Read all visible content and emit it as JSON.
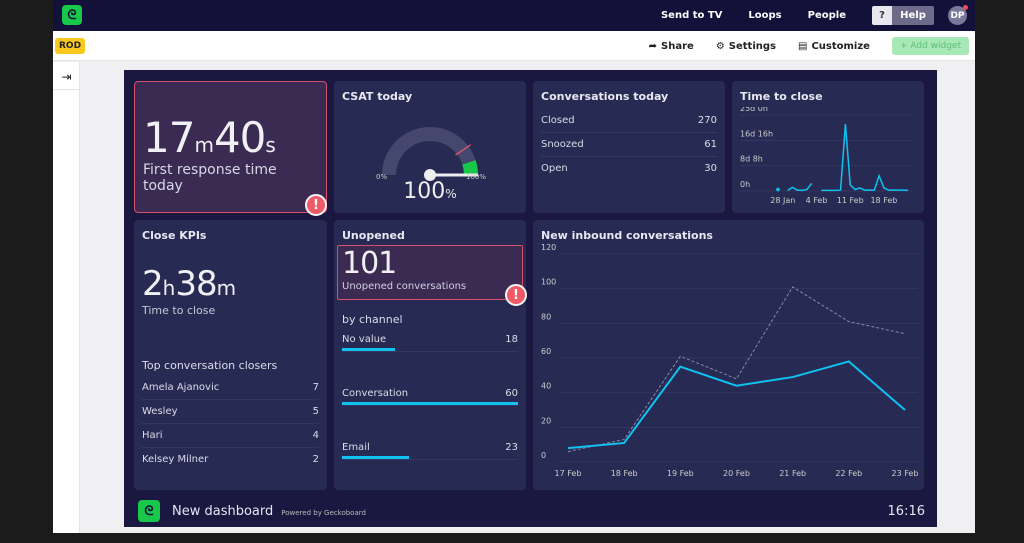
{
  "topbar": {
    "nav": [
      "Send to TV",
      "Loops",
      "People"
    ],
    "help_q": "?",
    "help": "Help",
    "avatar": "DP"
  },
  "toolbar": {
    "badge": "ROD",
    "share": "Share",
    "settings": "Settings",
    "customize": "Customize",
    "add_widget": "+ Add widget"
  },
  "colors": {
    "accent": "#0fc2f0",
    "alert": "#d9506a",
    "green": "#17c84a",
    "panel": "#272a52",
    "background": "#1a1740"
  },
  "widgets": {
    "frt": {
      "value_min": "17",
      "unit_min": "m",
      "value_sec": "40",
      "unit_sec": "s",
      "label": "First response time today",
      "alert": "!"
    },
    "csat": {
      "title": "CSAT today",
      "min": "0",
      "max": "100",
      "unit": "%",
      "value": "100",
      "value_pct": 100,
      "threshold_pct": 80
    },
    "conv": {
      "title": "Conversations today",
      "rows": [
        {
          "label": "Closed",
          "value": "270"
        },
        {
          "label": "Snoozed",
          "value": "61"
        },
        {
          "label": "Open",
          "value": "30"
        }
      ]
    },
    "ttc": {
      "title": "Time to close"
    },
    "close": {
      "title": "Close KPIs",
      "h": "2",
      "hu": "h",
      "m": "38",
      "mu": "m",
      "label": "Time to close",
      "list_title": "Top conversation closers",
      "rows": [
        {
          "label": "Amela Ajanovic",
          "value": "7"
        },
        {
          "label": "Wesley",
          "value": "5"
        },
        {
          "label": "Hari",
          "value": "4"
        },
        {
          "label": "Kelsey Milner",
          "value": "2"
        }
      ]
    },
    "unopened": {
      "title": "Unopened",
      "value": "101",
      "label": "Unopened conversations",
      "alert": "!",
      "by": "by channel",
      "channels": [
        {
          "label": "No value",
          "value": "18",
          "n": 18
        },
        {
          "label": "Conversation",
          "value": "60",
          "n": 60
        },
        {
          "label": "Email",
          "value": "23",
          "n": 23
        }
      ]
    },
    "inbound": {
      "title": "New inbound conversations"
    }
  },
  "chart_data": [
    {
      "type": "line",
      "title": "Time to close",
      "y_ticks": [
        "0h",
        "8d 8h",
        "16d 16h",
        "25d 0h"
      ],
      "ylim_days": [
        0,
        25
      ],
      "x_ticks": [
        "28 Jan",
        "4 Feb",
        "11 Feb",
        "18 Feb"
      ],
      "x": [
        "27 Jan",
        "28 Jan",
        "29 Jan",
        "30 Jan",
        "31 Jan",
        "1 Feb",
        "2 Feb",
        "3 Feb",
        "4 Feb",
        "5 Feb",
        "6 Feb",
        "7 Feb",
        "8 Feb",
        "9 Feb",
        "10 Feb",
        "11 Feb",
        "12 Feb",
        "13 Feb",
        "14 Feb",
        "15 Feb",
        "16 Feb",
        "17 Feb",
        "18 Feb",
        "19 Feb",
        "20 Feb",
        "21 Feb",
        "22 Feb",
        "23 Feb"
      ],
      "values_days": [
        0.5,
        null,
        0.2,
        1.2,
        0.3,
        0.2,
        0.5,
        2.5,
        null,
        0.2,
        0.2,
        0.2,
        0.2,
        0.3,
        22,
        2,
        0.5,
        1,
        0.3,
        0.3,
        0.3,
        5,
        1,
        0.3,
        0.3,
        0.3,
        0.3,
        0.2
      ],
      "grid": true
    },
    {
      "type": "line",
      "title": "New inbound conversations",
      "categories": [
        "17 Feb",
        "18 Feb",
        "19 Feb",
        "20 Feb",
        "21 Feb",
        "22 Feb",
        "23 Feb"
      ],
      "ylim": [
        0,
        120
      ],
      "y_ticks": [
        "0",
        "20",
        "40",
        "60",
        "80",
        "100",
        "120"
      ],
      "grid": true,
      "series": [
        {
          "style": "solid",
          "color": "#0fc2f0",
          "values": [
            8,
            11,
            55,
            44,
            49,
            58,
            30
          ]
        },
        {
          "style": "dashed",
          "color": "#8a8aa8",
          "values": [
            6,
            13,
            61,
            48,
            101,
            81,
            74
          ]
        }
      ]
    }
  ],
  "footer": {
    "name": "New dashboard",
    "powered": "Powered by Geckoboard",
    "time": "16:16"
  }
}
